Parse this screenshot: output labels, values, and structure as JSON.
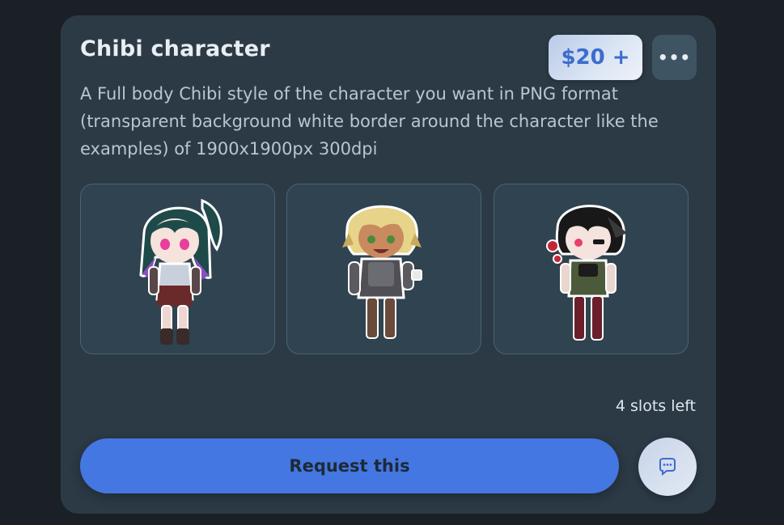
{
  "listing": {
    "title": "Chibi character",
    "price": "$20 +",
    "more_label": "•••",
    "description": "A Full body Chibi style of the character you want in PNG format (transparent background white border around the character like the examples) of 1900x1900px 300dpi",
    "slots_left": "4 slots left",
    "request_label": "Request this"
  },
  "gallery": [
    {
      "id": "example-1",
      "hair": "#1f4a4a",
      "hair_accent": "#8a4fc2",
      "eyes": "#e83f9b",
      "outfit": "#6b2a2a"
    },
    {
      "id": "example-2",
      "hair": "#e7d48a",
      "hair_accent": "#c9a95e",
      "eyes": "#4a8a3a",
      "outfit": "#4f4f55"
    },
    {
      "id": "example-3",
      "hair": "#181818",
      "hair_accent": "#3a3a3a",
      "eyes": "#e83f6b",
      "outfit": "#6a1f2a"
    }
  ],
  "icons": {
    "more": "more-horizontal-icon",
    "chat": "chat-bubble-icon"
  },
  "colors": {
    "card_bg": "#2c3a46",
    "accent": "#4477e1",
    "price_text": "#3d6ccd"
  }
}
